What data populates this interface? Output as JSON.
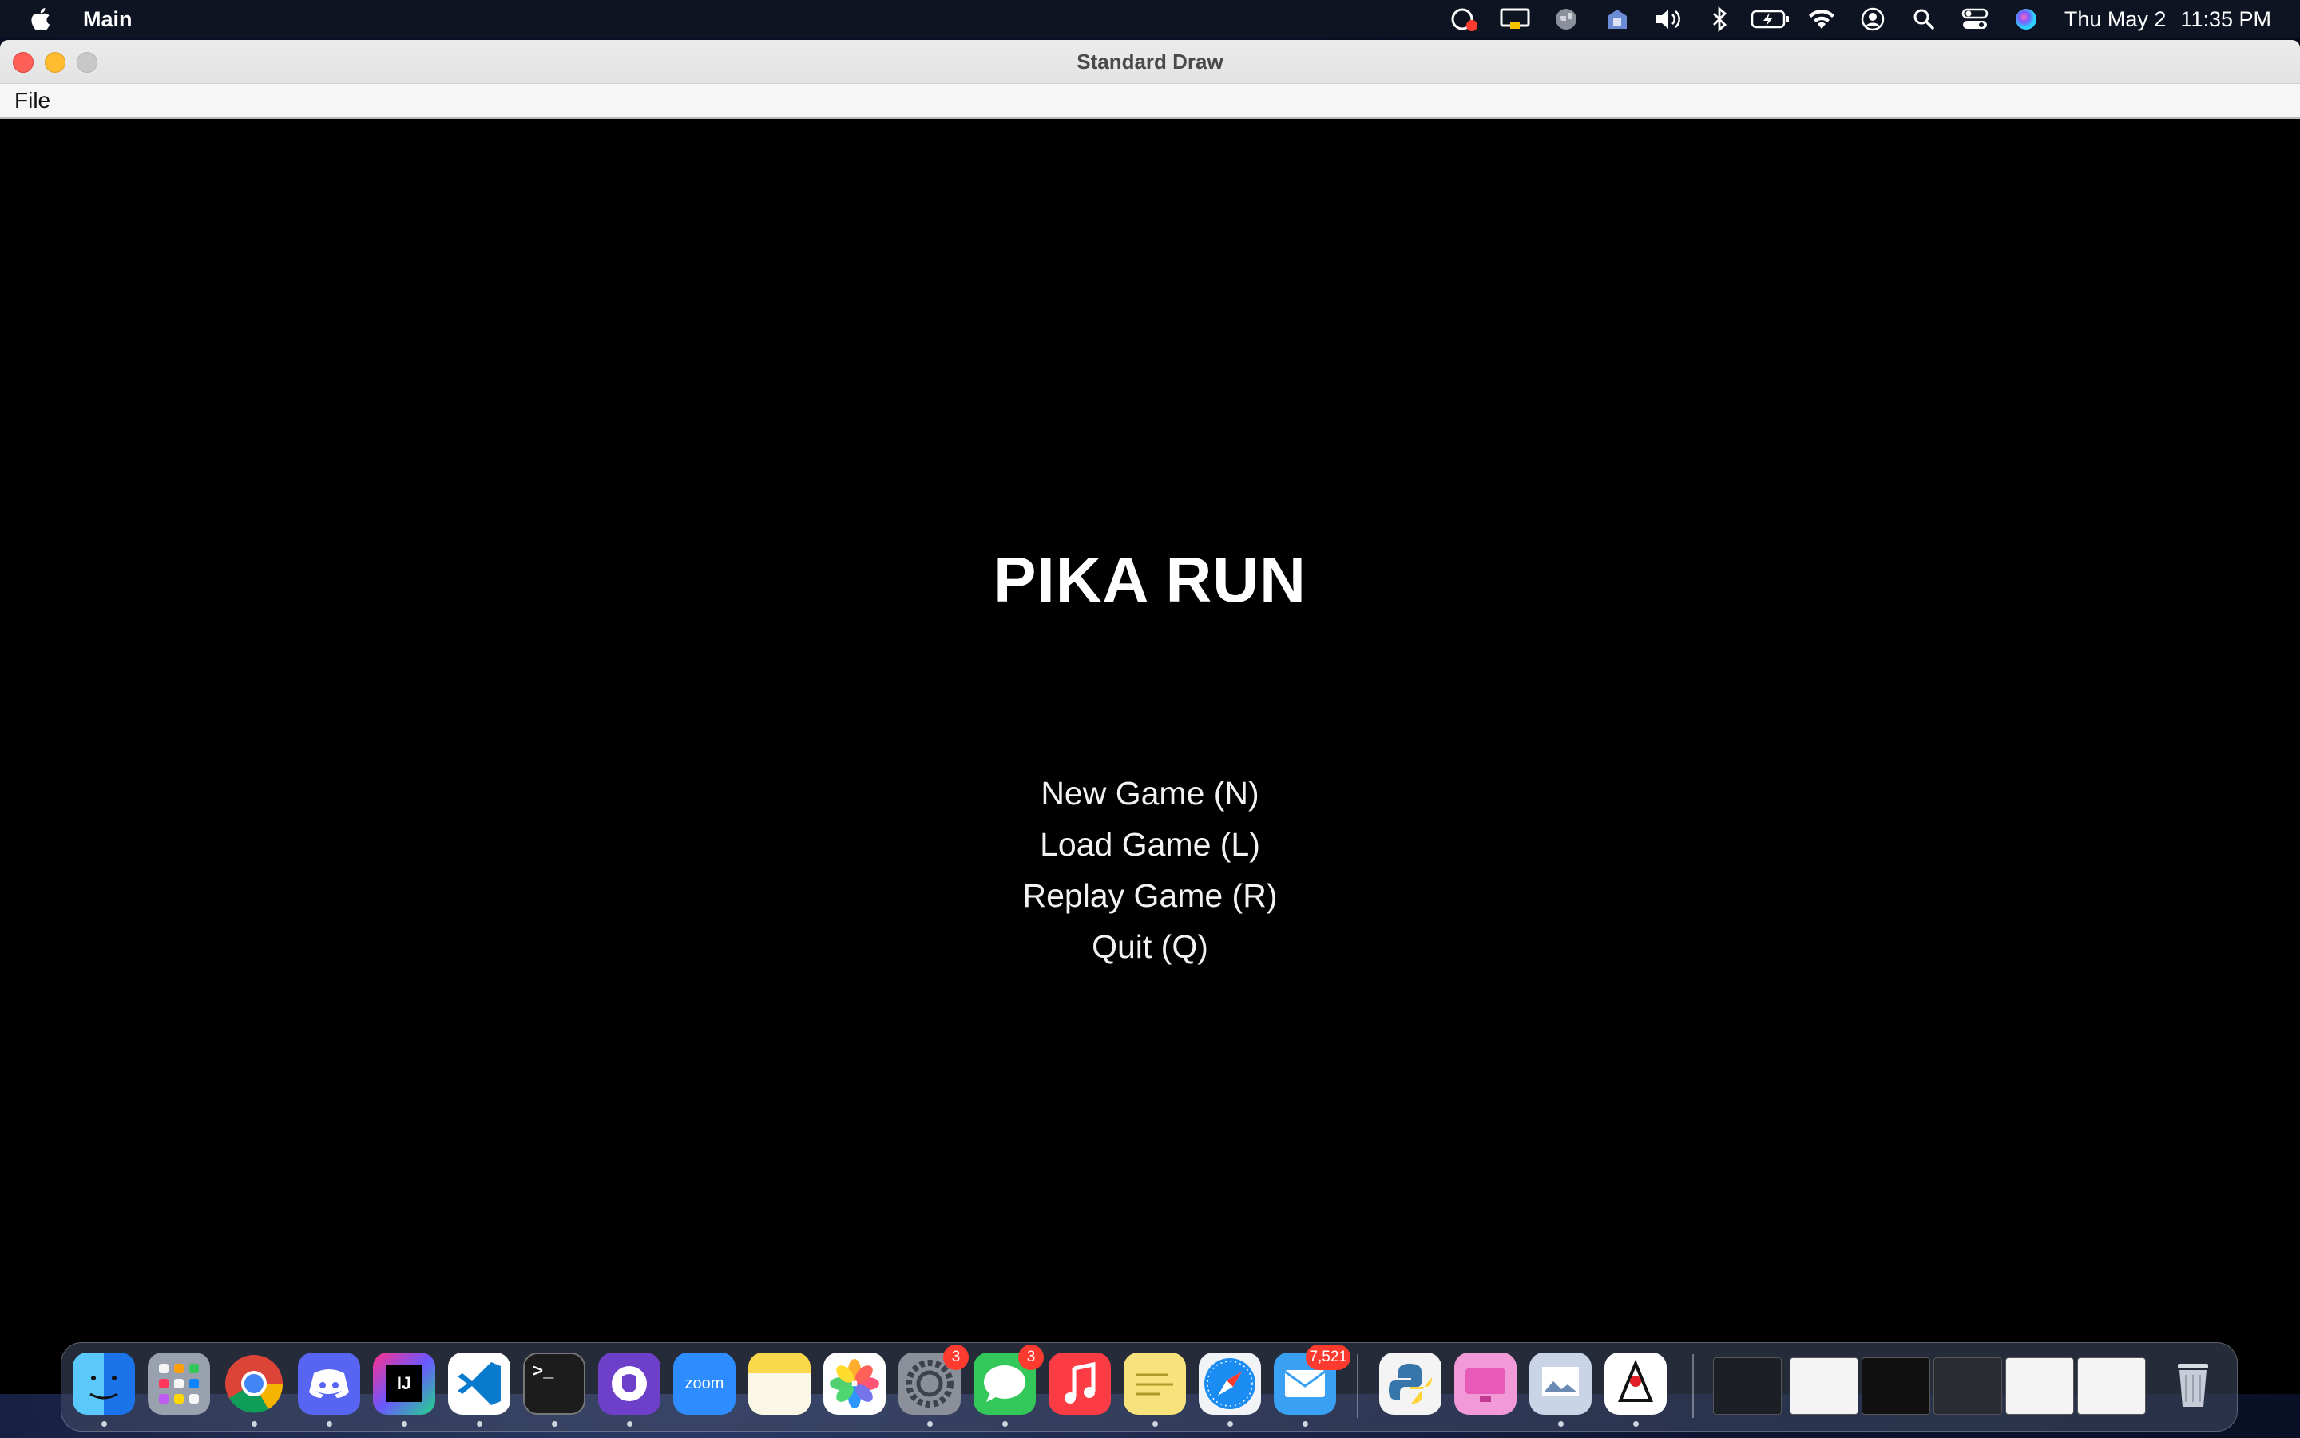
{
  "menubar": {
    "app_name": "Main",
    "clock_day": "Thu May 2",
    "clock_time": "11:35 PM",
    "status_icons": [
      "creative-cloud-icon",
      "display-icon",
      "globe-icon",
      "vpn-icon",
      "volume-icon",
      "bluetooth-icon",
      "battery-icon",
      "wifi-icon",
      "user-icon",
      "spotlight-icon",
      "control-center-icon",
      "siri-icon"
    ]
  },
  "window": {
    "title": "Standard Draw",
    "menu": [
      "File"
    ]
  },
  "game": {
    "title": "PIKA RUN",
    "options": [
      "New Game (N)",
      "Load Game (L)",
      "Replay Game (R)",
      "Quit (Q)"
    ]
  },
  "dock": {
    "apps": [
      {
        "name": "finder-icon",
        "color": "#2a7ef5"
      },
      {
        "name": "launchpad-icon",
        "color": "#8e96a6"
      },
      {
        "name": "chrome-icon",
        "color": "#ffffff"
      },
      {
        "name": "discord-icon",
        "color": "#5865f2"
      },
      {
        "name": "intellij-icon",
        "color": "#1a1a1a"
      },
      {
        "name": "vscode-icon",
        "color": "#ffffff"
      },
      {
        "name": "terminal-icon",
        "color": "#1c1c1c"
      },
      {
        "name": "github-desktop-icon",
        "color": "#6e40c9"
      },
      {
        "name": "zoom-icon",
        "color": "#2d8cff"
      },
      {
        "name": "notes-icon",
        "color": "#fbd84a"
      },
      {
        "name": "photos-icon",
        "color": "#ffffff"
      },
      {
        "name": "system-settings-icon",
        "color": "#8a8f99"
      },
      {
        "name": "messages-icon",
        "color": "#34c759"
      },
      {
        "name": "music-icon",
        "color": "#fc3c44"
      },
      {
        "name": "stickies-icon",
        "color": "#f7e27c"
      },
      {
        "name": "safari-icon",
        "color": "#1b8cf2"
      },
      {
        "name": "mail-icon",
        "color": "#3aa0f4"
      }
    ],
    "badges": {
      "system_settings": "3",
      "messages": "3",
      "mail": "7,521"
    },
    "zoom_label": "zoom",
    "terminal_label": ">_",
    "intellij_label": "IJ",
    "recent": [
      {
        "name": "python-launcher-icon",
        "color": "#f4f4f4"
      },
      {
        "name": "cleanmymac-icon",
        "color": "#f29ad8"
      },
      {
        "name": "preview-icon",
        "color": "#c9d5e6"
      },
      {
        "name": "java-icon",
        "color": "#ffffff"
      }
    ]
  }
}
